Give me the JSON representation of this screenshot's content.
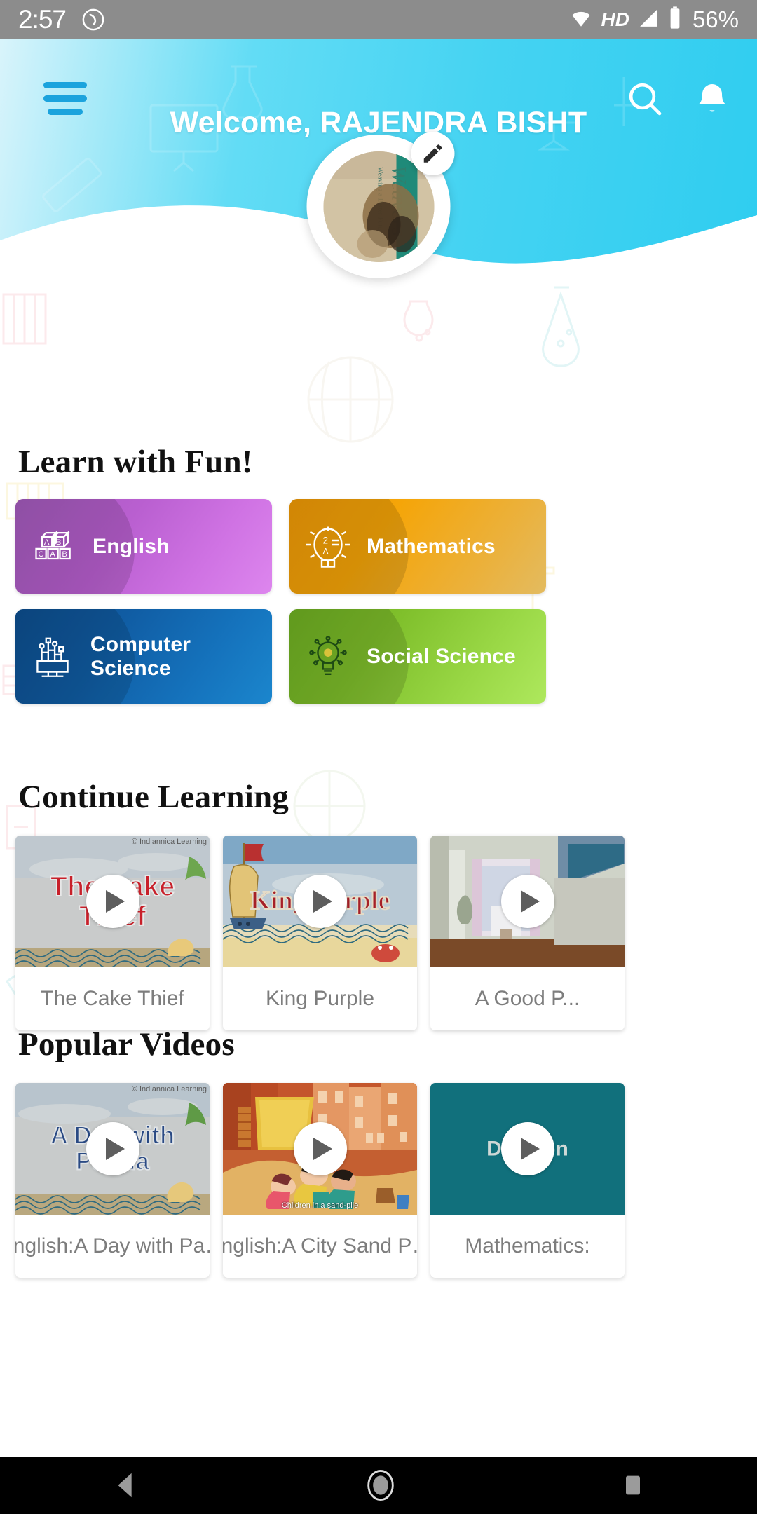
{
  "status_bar": {
    "time": "2:57",
    "call_icon": "call-forwarding-icon",
    "wifi_icon": "wifi-icon",
    "hd_label": "HD",
    "signal_icon": "signal-icon",
    "battery_icon": "battery-icon",
    "battery_percent": "56%"
  },
  "header": {
    "menu_icon": "hamburger-menu-icon",
    "welcome_text": "Welcome, RAJENDRA BISHT",
    "search_icon": "search-icon",
    "notification_icon": "bell-icon",
    "accent_color": "#45d3f2",
    "menu_color": "#1ba3dd"
  },
  "profile": {
    "avatar_label": "Weavers",
    "avatar_sub": "Weaving a Better Future",
    "edit_icon": "pencil-edit-icon"
  },
  "sections": {
    "learn": "Learn with Fun!",
    "continue": "Continue Learning",
    "popular": "Popular Videos"
  },
  "subjects": [
    {
      "label": "English",
      "icon": "abc-blocks-icon",
      "color": "#c167da"
    },
    {
      "label": "Mathematics",
      "icon": "gear-math-icon",
      "color": "#f2a40a"
    },
    {
      "label": "Computer Science",
      "icon": "computer-chip-icon",
      "color": "#1270ba"
    },
    {
      "label": "Social Science",
      "icon": "bulb-brain-icon",
      "color": "#93d342"
    }
  ],
  "continue_learning": [
    {
      "title": "The Cake Thief",
      "thumb_text": "The Cake Thief",
      "credit": "© Indiannica Learning"
    },
    {
      "title": "King Purple",
      "thumb_text": "King Purple",
      "credit": ""
    },
    {
      "title": "A Good P...",
      "thumb_text": "",
      "credit": ""
    }
  ],
  "popular_videos": [
    {
      "title": "English:A Day with Pa…",
      "thumb_text": "A Day with Panda",
      "caption": "",
      "credit": "© Indiannica Learning"
    },
    {
      "title": "English:A City Sand P…",
      "thumb_text": "",
      "caption": "Children in a sand-pile",
      "credit": ""
    },
    {
      "title": "Mathematics:",
      "thumb_text": "Division",
      "caption": "",
      "credit": ""
    }
  ],
  "nav_bar": {
    "back_icon": "back-triangle-icon",
    "home_icon": "home-circle-icon",
    "recents_icon": "recents-square-icon"
  }
}
